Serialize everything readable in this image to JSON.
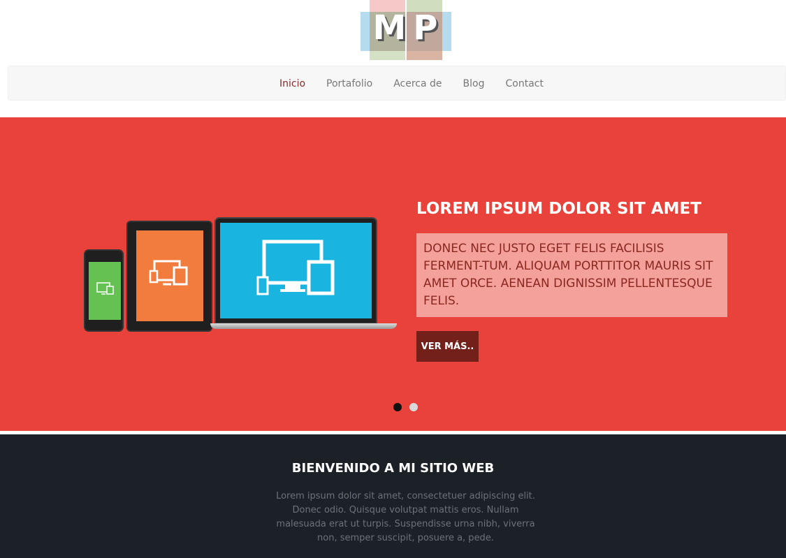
{
  "logo": {
    "letters": "MP"
  },
  "nav": {
    "items": [
      {
        "label": "Inicio",
        "active": true
      },
      {
        "label": "Portafolio",
        "active": false
      },
      {
        "label": "Acerca de",
        "active": false
      },
      {
        "label": "Blog",
        "active": false
      },
      {
        "label": "Contact",
        "active": false
      }
    ]
  },
  "hero": {
    "title": "LOREM IPSUM DOLOR SIT AMET",
    "text": "DONEC NEC JUSTO EGET FELIS FACILISIS FERMENT-TUM. ALIQUAM PORTTITOR MAURIS SIT AMET ORCE. AENEAN DIGNISSIM PELLENTESQUE FELIS.",
    "button_label": "VER MÁS..",
    "slides": 2,
    "active_slide": 1,
    "colors": {
      "background": "#e8423a",
      "text_box": "#f4a09b",
      "button": "#731f1a"
    },
    "devices": [
      "phone-icon",
      "tablet-icon",
      "laptop-icon"
    ]
  },
  "welcome": {
    "title": "BIENVENIDO A MI SITIO WEB",
    "text": "Lorem ipsum dolor sit amet, consectetuer adipiscing elit. Donec odio. Quisque volutpat mattis eros. Nullam malesuada erat ut turpis. Suspendisse urna nibh, viverra non, semper suscipit, posuere a, pede."
  }
}
